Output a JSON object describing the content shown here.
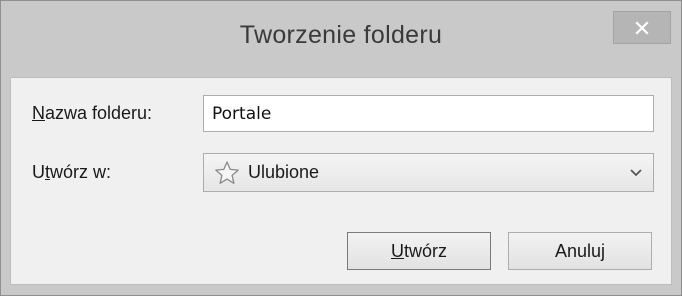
{
  "dialog": {
    "title": "Tworzenie folderu",
    "close_icon": "close-icon"
  },
  "form": {
    "name_label_accel": "N",
    "name_label_rest": "azwa folderu:",
    "name_value": "Portale",
    "location_label_pre": "U",
    "location_label_accel": "t",
    "location_label_rest": "wórz w:",
    "location_value": "Ulubione",
    "location_icon": "star-icon",
    "dropdown_icon": "chevron-down-icon"
  },
  "buttons": {
    "create_accel": "U",
    "create_rest": "twórz",
    "cancel_label": "Anuluj"
  }
}
